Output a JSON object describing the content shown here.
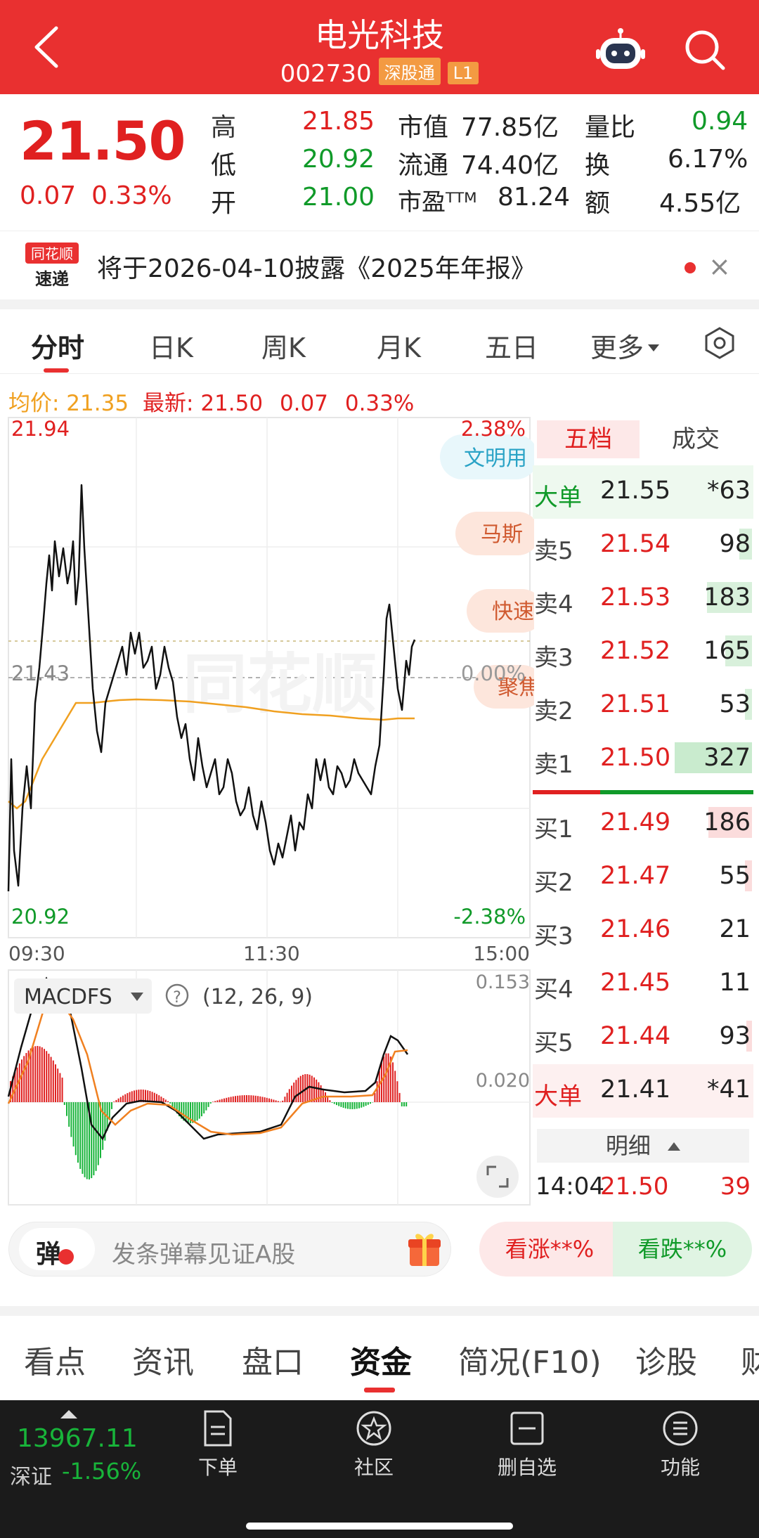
{
  "header": {
    "title": "电光科技",
    "code": "002730",
    "tag": "深股通",
    "level": "L1"
  },
  "quote": {
    "price": "21.50",
    "change": "0.07",
    "change_pct": "0.33%",
    "high_label": "高",
    "high": "21.85",
    "low_label": "低",
    "low": "20.92",
    "open_label": "开",
    "open": "21.00",
    "mcap_label": "市值",
    "mcap": "77.85亿",
    "float_label": "流通",
    "float": "74.40亿",
    "pe_label": "市盈ᵀᵀᴹ",
    "pe": "81.24",
    "vr_label": "量比",
    "vr": "0.94",
    "turn_label": "换",
    "turn": "6.17%",
    "amt_label": "额",
    "amt": "4.55亿"
  },
  "notice": {
    "logo_line1": "同花顺",
    "logo_line2": "速递",
    "text": "将于2026-04-10披露《2025年年报》",
    "close": "×"
  },
  "tabs": [
    "分时",
    "日K",
    "周K",
    "月K",
    "五日",
    "更多"
  ],
  "infoline": {
    "avg": "均价: 21.35",
    "last": "最新: 21.50",
    "chg": "0.07",
    "pct": "0.33%"
  },
  "chart": {
    "price_top": "21.94",
    "price_mid": "21.43",
    "price_bot": "20.92",
    "pct_top": "2.38%",
    "pct_mid": "0.00%",
    "pct_bot": "-2.38%",
    "time_start": "09:30",
    "time_mid": "11:30",
    "time_end": "15:00",
    "watermark": "同花顺",
    "bubbles": [
      "文明用",
      "马斯",
      "快速",
      "聚焦"
    ],
    "macd_name": "MACDFS",
    "macd_params": "(12, 26, 9)",
    "macd_top": "0.153",
    "macd_mid": "0.020",
    "colors": {
      "price": "#111111",
      "avg": "#f0a020",
      "up": "#e02020",
      "down": "#18b43a"
    }
  },
  "orderbook": {
    "tab_active": "五档",
    "tab_other": "成交",
    "big_top": {
      "label": "大单",
      "price": "21.55",
      "vol": "*63"
    },
    "sells": [
      {
        "label": "卖5",
        "price": "21.54",
        "vol": "98"
      },
      {
        "label": "卖4",
        "price": "21.53",
        "vol": "183"
      },
      {
        "label": "卖3",
        "price": "21.52",
        "vol": "165"
      },
      {
        "label": "卖2",
        "price": "21.51",
        "vol": "53"
      },
      {
        "label": "卖1",
        "price": "21.50",
        "vol": "327"
      }
    ],
    "buys": [
      {
        "label": "买1",
        "price": "21.49",
        "vol": "186"
      },
      {
        "label": "买2",
        "price": "21.47",
        "vol": "55"
      },
      {
        "label": "买3",
        "price": "21.46",
        "vol": "21"
      },
      {
        "label": "买4",
        "price": "21.45",
        "vol": "11"
      },
      {
        "label": "买5",
        "price": "21.44",
        "vol": "93"
      }
    ],
    "big_bot": {
      "label": "大单",
      "price": "21.41",
      "vol": "*41"
    },
    "detail_label": "明细",
    "detail_row": {
      "time": "14:04",
      "price": "21.50",
      "vol": "39"
    }
  },
  "danmu": {
    "icon": "弹",
    "placeholder": "发条弹幕见证A股",
    "bull": "看涨**%",
    "bear": "看跌**%"
  },
  "bottom_tabs": [
    "看点",
    "资讯",
    "盘口",
    "资金",
    "简况(F10)",
    "诊股",
    "财"
  ],
  "nav": {
    "index_value": "13967.11",
    "index_name": "深证",
    "index_pct": "-1.56%",
    "items": [
      "下单",
      "社区",
      "删自选",
      "功能"
    ]
  }
}
